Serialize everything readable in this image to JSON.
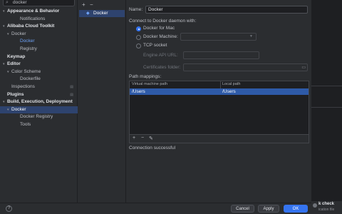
{
  "search": {
    "value": "docker"
  },
  "tree": [
    {
      "label": "Appearance & Behavior",
      "level": 0,
      "arrow": "down",
      "bold": true
    },
    {
      "label": "Notifications",
      "level": 2
    },
    {
      "label": "Alibaba Cloud Toolkit",
      "level": 0,
      "arrow": "down",
      "bold": true
    },
    {
      "label": "Docker",
      "level": 1,
      "arrow": "down"
    },
    {
      "label": "Docker",
      "level": 2,
      "blue": true
    },
    {
      "label": "Registry",
      "level": 2
    },
    {
      "label": "Keymap",
      "level": 0,
      "bold": true
    },
    {
      "label": "Editor",
      "level": 0,
      "arrow": "down",
      "bold": true
    },
    {
      "label": "Color Scheme",
      "level": 1,
      "arrow": "down"
    },
    {
      "label": "Dockerfile",
      "level": 2
    },
    {
      "label": "Inspections",
      "level": 1,
      "pin": true
    },
    {
      "label": "Plugins",
      "level": 0,
      "bold": true,
      "pin": true
    },
    {
      "label": "Build, Execution, Deployment",
      "level": 0,
      "arrow": "down",
      "bold": true
    },
    {
      "label": "Docker",
      "level": 1,
      "arrow": "down",
      "selected": true
    },
    {
      "label": "Docker Registry",
      "level": 2
    },
    {
      "label": "Tools",
      "level": 2
    }
  ],
  "middle": {
    "add_icon": "+",
    "remove_icon": "−",
    "item_label": "Docker"
  },
  "config": {
    "name_label": "Name:",
    "name_value": "Docker",
    "connect_label": "Connect to Docker daemon with:",
    "opt_mac": "Docker for Mac",
    "opt_machine": "Docker Machine:",
    "opt_tcp": "TCP socket",
    "engine_label": "Engine API URL:",
    "cert_label": "Certificates folder:",
    "path_mappings_label": "Path mappings:",
    "col_vm": "Virtual machine path",
    "col_local": "Local path",
    "row_vm": "/Users",
    "row_local": "/Users",
    "status": "Connection successful"
  },
  "toolbar": {
    "add": "+",
    "remove": "−",
    "edit": "✎"
  },
  "buttons": {
    "help": "?",
    "cancel": "Cancel",
    "apply": "Apply",
    "ok": "OK"
  },
  "notification": {
    "title": "k check",
    "subtitle": "ication file"
  },
  "colors": {
    "accent": "#3574f0",
    "selection": "#2e436e",
    "panel": "#2b2d30"
  }
}
